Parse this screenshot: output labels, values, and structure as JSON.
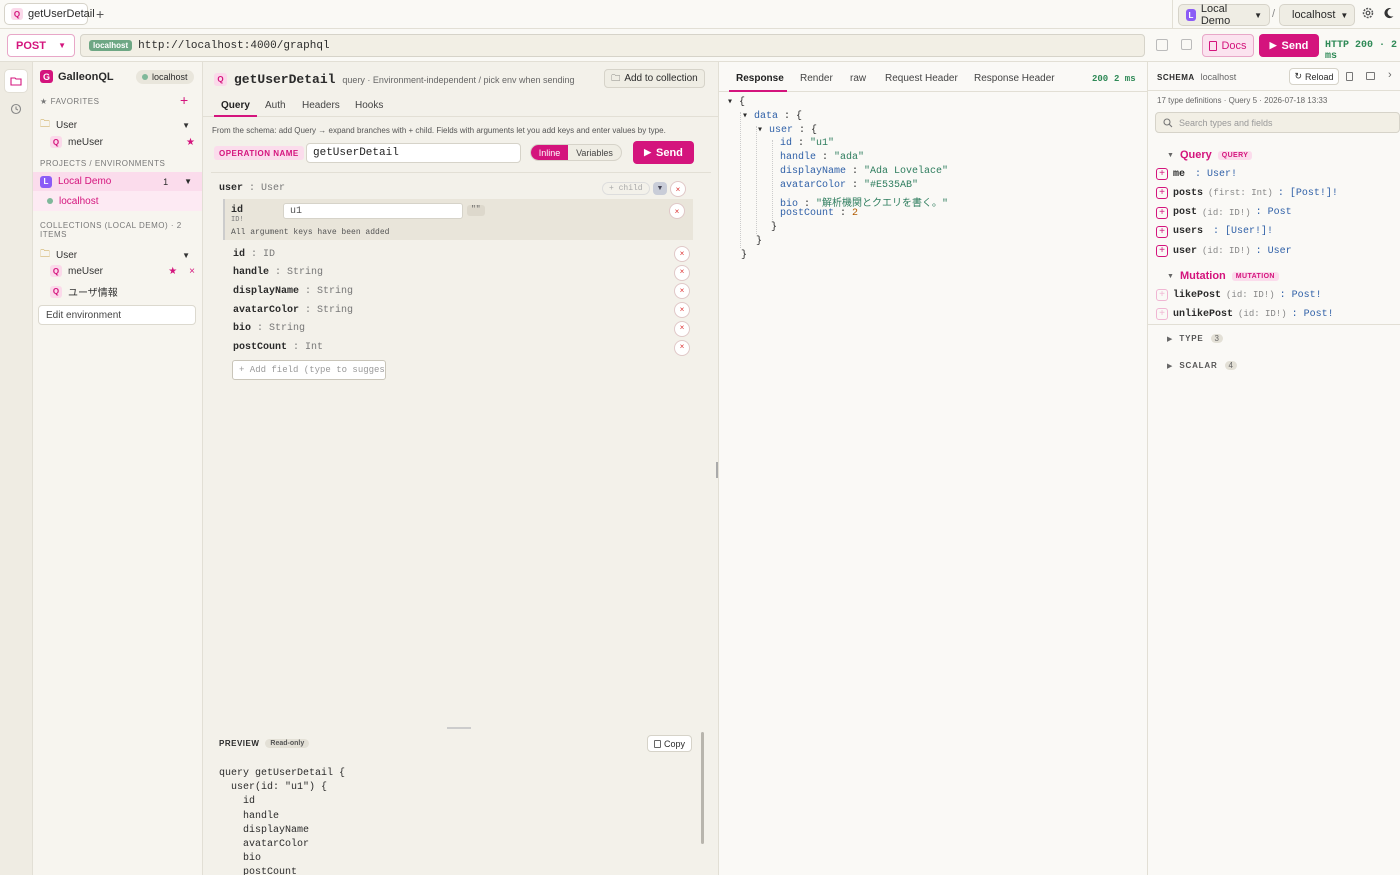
{
  "tabbar": {
    "tab_label": "getUserDetail",
    "env_label": "Local Demo",
    "env_separator": "/",
    "host_label": "localhost"
  },
  "urlbar": {
    "method": "POST",
    "host_badge": "localhost",
    "url": "http://localhost:4000/graphql",
    "docs_label": "Docs",
    "send_label": "Send",
    "status": "HTTP 200 · 2 ms"
  },
  "sidebar": {
    "app_name": "GalleonQL",
    "env_badge": "localhost",
    "favorites_heading": "FAVORITES",
    "favorites_folder": "User",
    "favorites_item": "meUser",
    "projects_heading": "PROJECTS / ENVIRONMENTS",
    "project_name": "Local Demo",
    "project_count": "1",
    "project_env": "localhost",
    "collections_heading": "COLLECTIONS (LOCAL DEMO) · 2 ITEMS",
    "collections_folder": "User",
    "collection_items": [
      "meUser",
      "ユーザ情報"
    ],
    "edit_env_label": "Edit environment"
  },
  "query": {
    "title": "getUserDetail",
    "subtitle": "query · Environment-independent / pick env when sending",
    "add_collection": "Add to collection",
    "tabs": [
      "Query",
      "Auth",
      "Headers",
      "Hooks"
    ],
    "hint": "From the schema: add Query → expand branches with + child. Fields with arguments let you add keys and enter values by type.",
    "operation_label": "OPERATION NAME",
    "operation_name": "getUserDetail",
    "mode_inline": "Inline",
    "mode_variables": "Variables",
    "send_label": "Send",
    "root_field": "user",
    "root_type": "User",
    "child_btn": "+ child",
    "arg_name": "id",
    "arg_type": "ID!",
    "arg_value": "u1",
    "arg_quote": "\"\"",
    "arg_note": "All argument keys have been added",
    "fields": [
      {
        "name": "id",
        "type": "ID"
      },
      {
        "name": "handle",
        "type": "String"
      },
      {
        "name": "displayName",
        "type": "String"
      },
      {
        "name": "avatarColor",
        "type": "String"
      },
      {
        "name": "bio",
        "type": "String"
      },
      {
        "name": "postCount",
        "type": "Int"
      }
    ],
    "add_field_placeholder": "+ Add field (type to suggest)",
    "preview_label": "PREVIEW",
    "readonly_label": "Read-only",
    "copy_label": "Copy",
    "preview_lines": [
      "query getUserDetail {",
      "  user(id: \"u1\") {",
      "    id",
      "    handle",
      "    displayName",
      "    avatarColor",
      "    bio",
      "    postCount"
    ]
  },
  "response": {
    "tabs": [
      "Response",
      "Render",
      "raw",
      "Request Header",
      "Response Header"
    ],
    "status": "200",
    "time": "2 ms",
    "json": {
      "id": "\"u1\"",
      "handle": "\"ada\"",
      "displayName": "\"Ada Lovelace\"",
      "avatarColor": "\"#E535AB\"",
      "bio": "\"解析機関とクエリを書く。\"",
      "postCount": "2"
    }
  },
  "schema": {
    "title": "SCHEMA",
    "host": "localhost",
    "reload_label": "Reload",
    "meta": "17 type definitions · Query 5 · 2026-07-18 13:33",
    "search_placeholder": "Search types and fields",
    "query_heading": "Query",
    "query_tag": "QUERY",
    "query_fields": [
      {
        "name": "me",
        "args": "",
        "type": ": User!"
      },
      {
        "name": "posts",
        "args": "(first: Int)",
        "type": ": [Post!]!"
      },
      {
        "name": "post",
        "args": "(id: ID!)",
        "type": ": Post"
      },
      {
        "name": "users",
        "args": "",
        "type": ": [User!]!"
      },
      {
        "name": "user",
        "args": "(id: ID!)",
        "type": ": User"
      }
    ],
    "mutation_heading": "Mutation",
    "mutation_tag": "MUTATION",
    "mutation_fields": [
      {
        "name": "likePost",
        "args": "(id: ID!)",
        "type": ": Post!"
      },
      {
        "name": "unlikePost",
        "args": "(id: ID!)",
        "type": ": Post!"
      }
    ],
    "type_label": "TYPE",
    "type_count": "3",
    "scalar_label": "SCALAR",
    "scalar_count": "4"
  }
}
